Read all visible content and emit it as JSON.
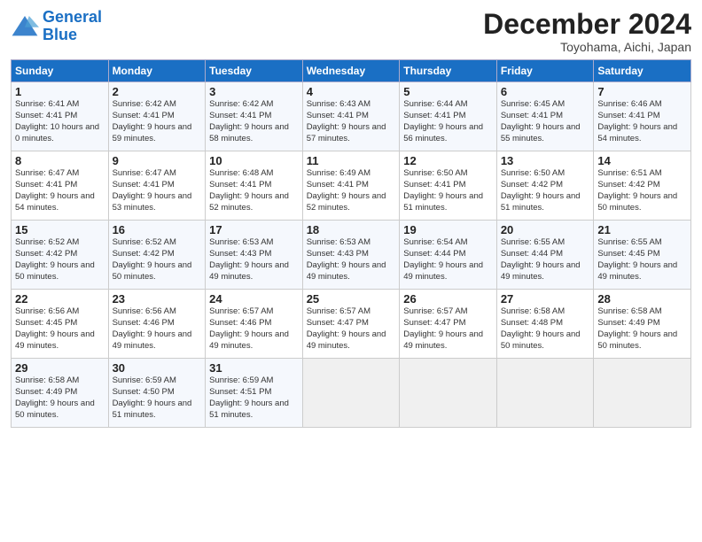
{
  "logo": {
    "line1": "General",
    "line2": "Blue"
  },
  "header": {
    "month": "December 2024",
    "location": "Toyohama, Aichi, Japan"
  },
  "days_of_week": [
    "Sunday",
    "Monday",
    "Tuesday",
    "Wednesday",
    "Thursday",
    "Friday",
    "Saturday"
  ],
  "weeks": [
    [
      {
        "day": "1",
        "sunrise": "6:41 AM",
        "sunset": "4:41 PM",
        "daylight": "10 hours and 0 minutes."
      },
      {
        "day": "2",
        "sunrise": "6:42 AM",
        "sunset": "4:41 PM",
        "daylight": "9 hours and 59 minutes."
      },
      {
        "day": "3",
        "sunrise": "6:42 AM",
        "sunset": "4:41 PM",
        "daylight": "9 hours and 58 minutes."
      },
      {
        "day": "4",
        "sunrise": "6:43 AM",
        "sunset": "4:41 PM",
        "daylight": "9 hours and 57 minutes."
      },
      {
        "day": "5",
        "sunrise": "6:44 AM",
        "sunset": "4:41 PM",
        "daylight": "9 hours and 56 minutes."
      },
      {
        "day": "6",
        "sunrise": "6:45 AM",
        "sunset": "4:41 PM",
        "daylight": "9 hours and 55 minutes."
      },
      {
        "day": "7",
        "sunrise": "6:46 AM",
        "sunset": "4:41 PM",
        "daylight": "9 hours and 54 minutes."
      }
    ],
    [
      {
        "day": "8",
        "sunrise": "6:47 AM",
        "sunset": "4:41 PM",
        "daylight": "9 hours and 54 minutes."
      },
      {
        "day": "9",
        "sunrise": "6:47 AM",
        "sunset": "4:41 PM",
        "daylight": "9 hours and 53 minutes."
      },
      {
        "day": "10",
        "sunrise": "6:48 AM",
        "sunset": "4:41 PM",
        "daylight": "9 hours and 52 minutes."
      },
      {
        "day": "11",
        "sunrise": "6:49 AM",
        "sunset": "4:41 PM",
        "daylight": "9 hours and 52 minutes."
      },
      {
        "day": "12",
        "sunrise": "6:50 AM",
        "sunset": "4:41 PM",
        "daylight": "9 hours and 51 minutes."
      },
      {
        "day": "13",
        "sunrise": "6:50 AM",
        "sunset": "4:42 PM",
        "daylight": "9 hours and 51 minutes."
      },
      {
        "day": "14",
        "sunrise": "6:51 AM",
        "sunset": "4:42 PM",
        "daylight": "9 hours and 50 minutes."
      }
    ],
    [
      {
        "day": "15",
        "sunrise": "6:52 AM",
        "sunset": "4:42 PM",
        "daylight": "9 hours and 50 minutes."
      },
      {
        "day": "16",
        "sunrise": "6:52 AM",
        "sunset": "4:42 PM",
        "daylight": "9 hours and 50 minutes."
      },
      {
        "day": "17",
        "sunrise": "6:53 AM",
        "sunset": "4:43 PM",
        "daylight": "9 hours and 49 minutes."
      },
      {
        "day": "18",
        "sunrise": "6:53 AM",
        "sunset": "4:43 PM",
        "daylight": "9 hours and 49 minutes."
      },
      {
        "day": "19",
        "sunrise": "6:54 AM",
        "sunset": "4:44 PM",
        "daylight": "9 hours and 49 minutes."
      },
      {
        "day": "20",
        "sunrise": "6:55 AM",
        "sunset": "4:44 PM",
        "daylight": "9 hours and 49 minutes."
      },
      {
        "day": "21",
        "sunrise": "6:55 AM",
        "sunset": "4:45 PM",
        "daylight": "9 hours and 49 minutes."
      }
    ],
    [
      {
        "day": "22",
        "sunrise": "6:56 AM",
        "sunset": "4:45 PM",
        "daylight": "9 hours and 49 minutes."
      },
      {
        "day": "23",
        "sunrise": "6:56 AM",
        "sunset": "4:46 PM",
        "daylight": "9 hours and 49 minutes."
      },
      {
        "day": "24",
        "sunrise": "6:57 AM",
        "sunset": "4:46 PM",
        "daylight": "9 hours and 49 minutes."
      },
      {
        "day": "25",
        "sunrise": "6:57 AM",
        "sunset": "4:47 PM",
        "daylight": "9 hours and 49 minutes."
      },
      {
        "day": "26",
        "sunrise": "6:57 AM",
        "sunset": "4:47 PM",
        "daylight": "9 hours and 49 minutes."
      },
      {
        "day": "27",
        "sunrise": "6:58 AM",
        "sunset": "4:48 PM",
        "daylight": "9 hours and 50 minutes."
      },
      {
        "day": "28",
        "sunrise": "6:58 AM",
        "sunset": "4:49 PM",
        "daylight": "9 hours and 50 minutes."
      }
    ],
    [
      {
        "day": "29",
        "sunrise": "6:58 AM",
        "sunset": "4:49 PM",
        "daylight": "9 hours and 50 minutes."
      },
      {
        "day": "30",
        "sunrise": "6:59 AM",
        "sunset": "4:50 PM",
        "daylight": "9 hours and 51 minutes."
      },
      {
        "day": "31",
        "sunrise": "6:59 AM",
        "sunset": "4:51 PM",
        "daylight": "9 hours and 51 minutes."
      },
      null,
      null,
      null,
      null
    ]
  ]
}
